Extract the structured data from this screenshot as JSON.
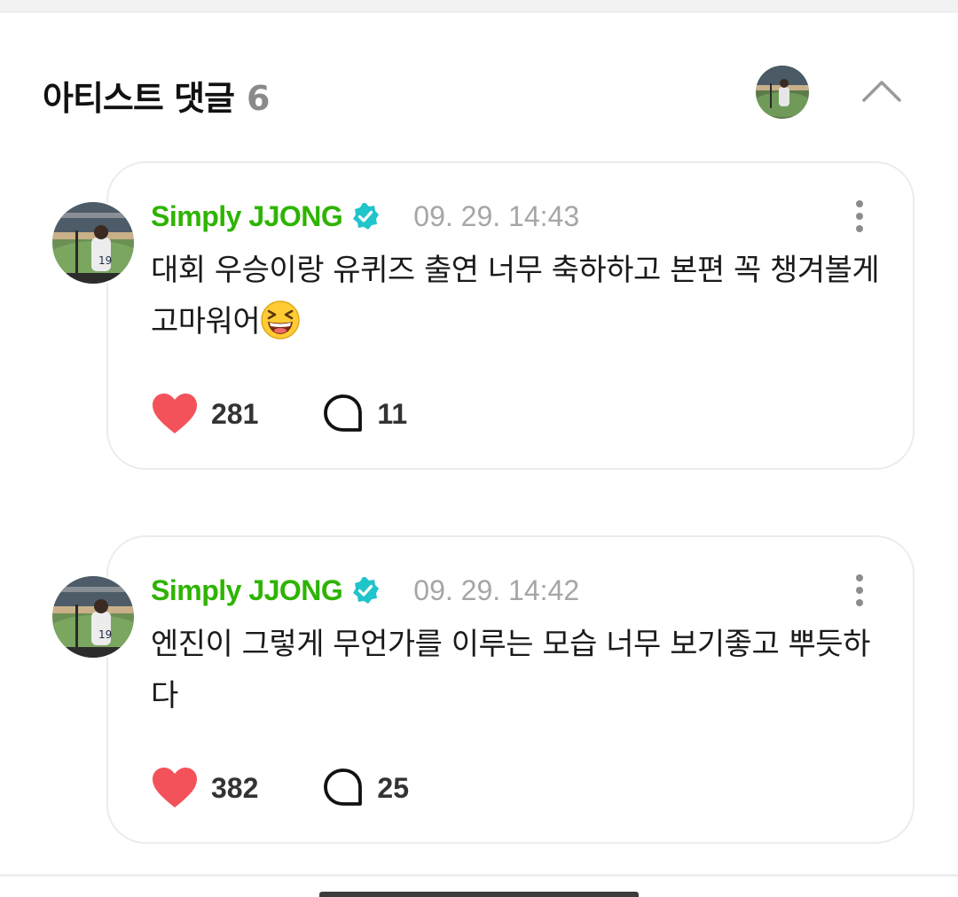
{
  "header": {
    "title": "아티스트 댓글",
    "count": "6",
    "avatar_icon": "profile-photo"
  },
  "comments": [
    {
      "author": "Simply JJONG",
      "verified": true,
      "timestamp": "09. 29. 14:43",
      "text": "대회 우승이랑 유퀴즈 출연 너무 축하하고 본편 꼭 챙겨볼게 고마워어",
      "emoji": "grinning-squinting-face",
      "likes": "281",
      "replies": "11"
    },
    {
      "author": "Simply JJONG",
      "verified": true,
      "timestamp": "09. 29. 14:42",
      "text": "엔진이 그렇게 무언가를 이루는 모습 너무 보기좋고 뿌듯하다",
      "likes": "382",
      "replies": "25"
    }
  ],
  "colors": {
    "author": "#2db400",
    "verified_badge": "#20c4cb",
    "heart": "#f4525a",
    "timestamp": "#a6a6a6"
  }
}
